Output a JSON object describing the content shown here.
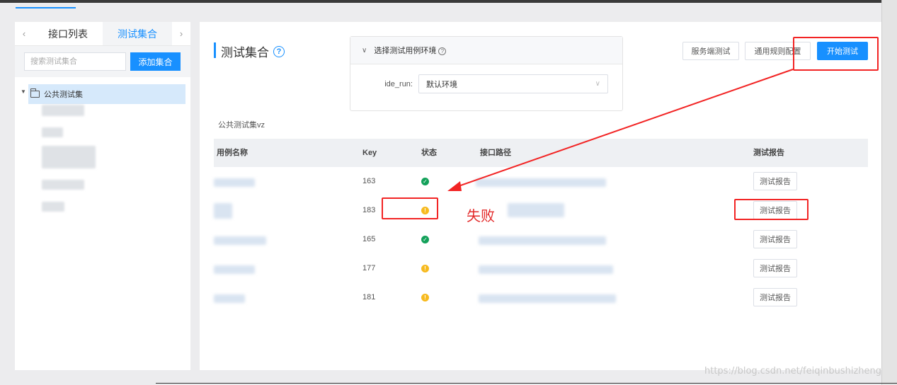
{
  "left": {
    "tabs": [
      {
        "label": "接口列表",
        "active": false
      },
      {
        "label": "测试集合",
        "active": true
      }
    ],
    "prev_arrow": "‹",
    "next_arrow": "›",
    "search_placeholder": "搜索测试集合",
    "add_button": "添加集合",
    "tree_root": "公共测试集"
  },
  "main": {
    "title": "测试集合",
    "help": "?",
    "env": {
      "header": "选择测试用例环境",
      "label": "ide_run:",
      "selected": "默认环境"
    },
    "buttons": {
      "server_test": "服务端测试",
      "rules_config": "通用规则配置",
      "start_test": "开始测试"
    },
    "collection_name": "公共测试集vz",
    "table": {
      "headers": {
        "name": "用例名称",
        "key": "Key",
        "status": "状态",
        "path": "接口路径",
        "report": "测试报告"
      },
      "rows": [
        {
          "key": "163",
          "status": "ok",
          "report": "测试报告"
        },
        {
          "key": "183",
          "status": "warn",
          "report": "测试报告"
        },
        {
          "key": "165",
          "status": "ok",
          "report": "测试报告"
        },
        {
          "key": "177",
          "status": "warn",
          "report": "测试报告"
        },
        {
          "key": "181",
          "status": "warn",
          "report": "测试报告"
        }
      ]
    }
  },
  "annotation": {
    "fail_text": "失败",
    "color": "#f22424"
  },
  "watermark": "https://blog.csdn.net/feiqinbushizheng",
  "colors": {
    "accent": "#1890ff",
    "ok": "#13a15a",
    "warn": "#f7ba1e"
  },
  "icons": {
    "status_ok": "check-circle-icon",
    "status_warn": "exclamation-circle-icon",
    "folder": "folder-icon"
  }
}
